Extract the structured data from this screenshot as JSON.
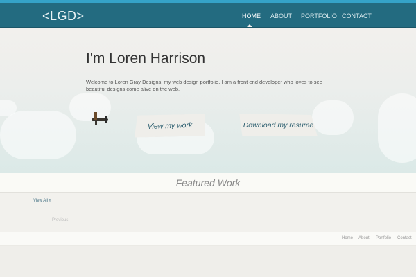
{
  "header": {
    "logo": "<LGD>",
    "nav": [
      {
        "label": "HOME",
        "active": true
      },
      {
        "label": "ABOUT"
      },
      {
        "label": "PORTFOLIO"
      },
      {
        "label": "CONTACT"
      }
    ]
  },
  "hero": {
    "title": "I'm Loren Harrison",
    "intro": "Welcome to Loren Gray Designs, my web design portfolio. I am a front end developer who loves to see beautiful designs come alive on the web.",
    "view_work": "View my work",
    "download_resume": "Download my resume"
  },
  "featured": {
    "title": "Featured Work",
    "view_all": "View All »",
    "previous": "Previous"
  },
  "footer": {
    "links": [
      "Home",
      "About",
      "Portfolio",
      "Contact"
    ]
  }
}
